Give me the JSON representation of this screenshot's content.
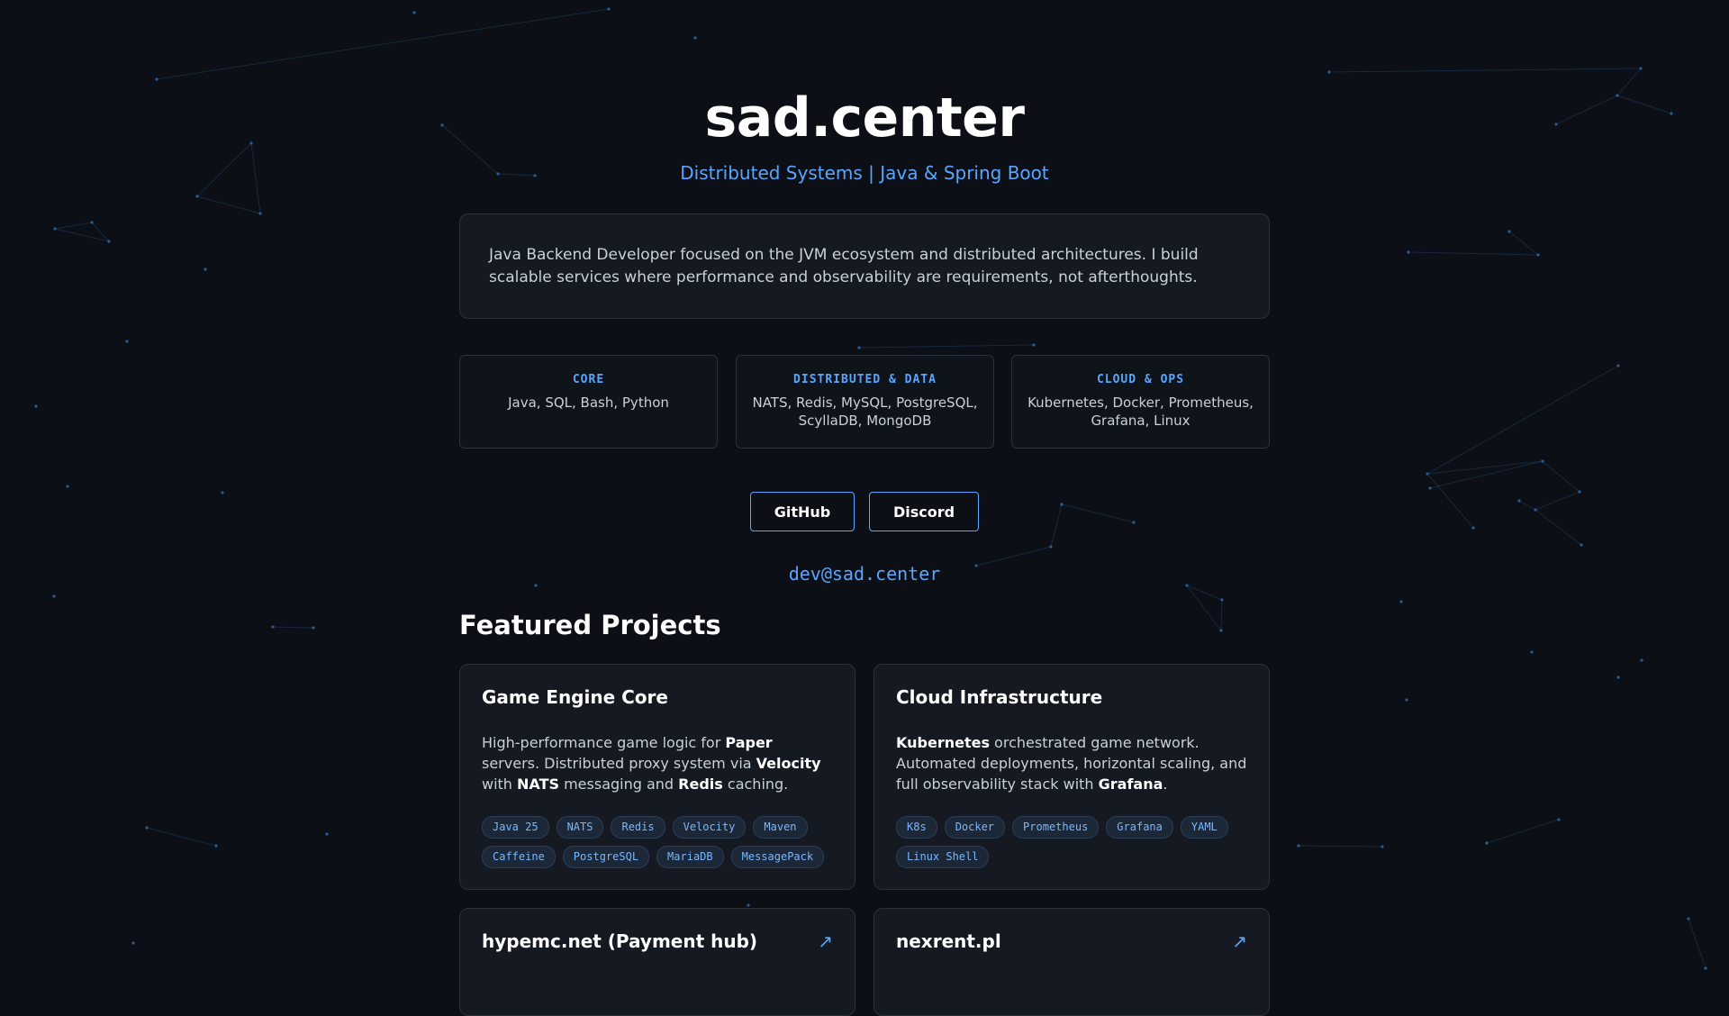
{
  "site": {
    "title": "sad.center",
    "tagline": "Distributed Systems | Java & Spring Boot",
    "about": "Java Backend Developer focused on the JVM ecosystem and distributed architectures. I build scalable services where performance and observability are requirements, not afterthoughts."
  },
  "skills": [
    {
      "title": "CORE",
      "items": "Java, SQL, Bash, Python"
    },
    {
      "title": "DISTRIBUTED & DATA",
      "items": "NATS, Redis, MySQL, PostgreSQL, ScyllaDB, MongoDB"
    },
    {
      "title": "CLOUD & OPS",
      "items": "Kubernetes, Docker, Prometheus, Grafana, Linux"
    }
  ],
  "links": {
    "github": "GitHub",
    "discord": "Discord",
    "email": "dev@sad.center"
  },
  "projects_heading": "Featured Projects",
  "projects": [
    {
      "title": "Game Engine Core",
      "desc": [
        {
          "t": "High-performance game logic for "
        },
        {
          "t": "Paper",
          "b": true
        },
        {
          "t": " servers. Distributed proxy system via "
        },
        {
          "t": "Velocity",
          "b": true
        },
        {
          "t": " with "
        },
        {
          "t": "NATS",
          "b": true
        },
        {
          "t": " messaging and "
        },
        {
          "t": "Redis",
          "b": true
        },
        {
          "t": " caching."
        }
      ],
      "tags": [
        "Java 25",
        "NATS",
        "Redis",
        "Velocity",
        "Maven",
        "Caffeine",
        "PostgreSQL",
        "MariaDB",
        "MessagePack"
      ]
    },
    {
      "title": "Cloud Infrastructure",
      "desc": [
        {
          "t": "Kubernetes",
          "b": true
        },
        {
          "t": " orchestrated game network. Automated deployments, horizontal scaling, and full observability stack with "
        },
        {
          "t": "Grafana",
          "b": true
        },
        {
          "t": "."
        }
      ],
      "tags": [
        "K8s",
        "Docker",
        "Prometheus",
        "Grafana",
        "YAML",
        "Linux Shell"
      ]
    },
    {
      "title": "hypemc.net (Payment hub)",
      "arrow": "↗"
    },
    {
      "title": "nexrent.pl",
      "arrow": "↗"
    }
  ],
  "colors": {
    "background": "#0c0f15",
    "accent": "#58a6ff",
    "card": "#141922"
  }
}
